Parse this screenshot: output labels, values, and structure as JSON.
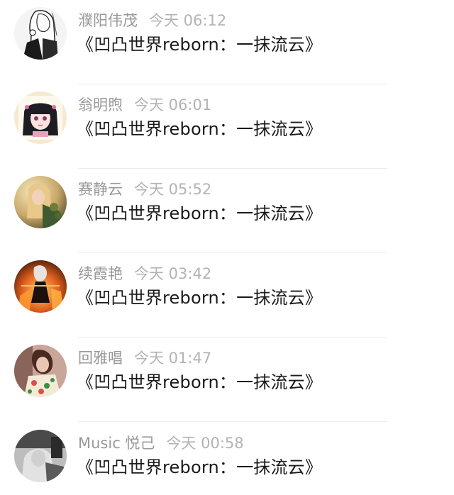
{
  "comments": [
    {
      "name": "濮阳伟茂",
      "time": "今天 06:12",
      "text": "《凹凸世界reborn：一抹流云》",
      "avatar": "monochrome-manga-girl-avatar"
    },
    {
      "name": "翁明煦",
      "time": "今天 06:01",
      "text": "《凹凸世界reborn：一抹流云》",
      "avatar": "anime-girl-black-hair-avatar"
    },
    {
      "name": "赛静云",
      "time": "今天 05:52",
      "text": "《凹凸世界reborn：一抹流云》",
      "avatar": "blonde-girl-photo-avatar"
    },
    {
      "name": "续霞艳",
      "time": "今天 03:42",
      "text": "《凹凸世界reborn：一抹流云》",
      "avatar": "anime-fire-warrior-avatar"
    },
    {
      "name": "回雅唱",
      "time": "今天 01:47",
      "text": "《凹凸世界reborn：一抹流云》",
      "avatar": "floral-dress-girl-avatar"
    },
    {
      "name": "Music 悦己",
      "time": "今天 00:58",
      "text": "《凹凸世界reborn：一抹流云》",
      "avatar": "grayscale-photo-avatar"
    }
  ]
}
